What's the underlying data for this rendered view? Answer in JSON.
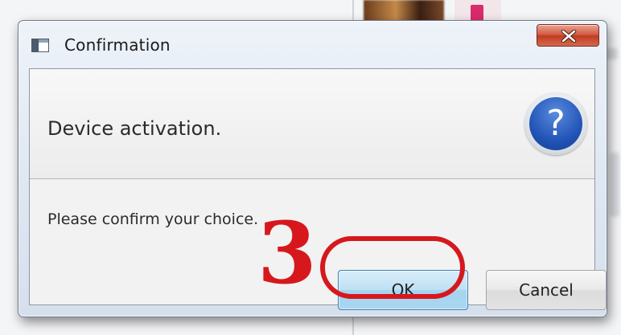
{
  "dialog": {
    "title": "Confirmation",
    "header_text": "Device activation.",
    "message": "Please confirm your choice.",
    "ok_label": "OK",
    "cancel_label": "Cancel",
    "icons": {
      "app": "window-icon",
      "close": "close-icon",
      "question": "question-icon"
    }
  },
  "annotation": {
    "step_number": "3",
    "color": "#d6181d"
  }
}
